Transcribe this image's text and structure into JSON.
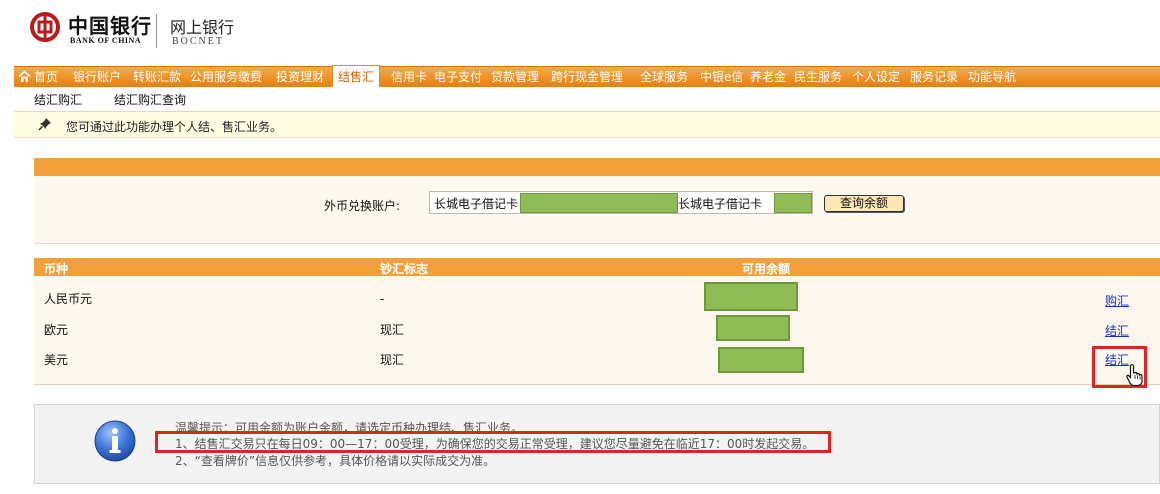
{
  "header": {
    "bank_name_cn": "中国银行",
    "bank_name_en": "BANK OF CHINA",
    "service_cn": "网上银行",
    "service_en": "BOCNET",
    "brand_color": "#b71c1c"
  },
  "nav": {
    "items": [
      "首页",
      "银行账户",
      "转账汇款",
      "公用服务缴费",
      "投资理财",
      "结售汇",
      "信用卡",
      "电子支付",
      "贷款管理",
      "跨行现金管理",
      "全球服务",
      "中银e信",
      "养老金",
      "民生服务",
      "个人设定",
      "服务记录",
      "功能导航"
    ],
    "active": "结售汇",
    "home_icon": "home-icon",
    "color": "#e8860f"
  },
  "subnav": {
    "items": [
      "结汇购汇",
      "结汇购汇查询"
    ]
  },
  "info": {
    "text": "您可通过此功能办理个人结、售汇业务。",
    "icon": "pin-icon"
  },
  "account": {
    "label": "外币兑换账户:",
    "select_prefix": "长城电子借记卡",
    "select_suffix": "长城电子借记卡",
    "query_button": "查询余额"
  },
  "table": {
    "headers": [
      "币种",
      "钞汇标志",
      "可用余额"
    ],
    "rows": [
      {
        "currency": "人民币元",
        "flag": "-",
        "action": "购汇"
      },
      {
        "currency": "欧元",
        "flag": "现汇",
        "action": "结汇"
      },
      {
        "currency": "美元",
        "flag": "现汇",
        "action": "结汇"
      }
    ]
  },
  "tips": {
    "icon": "info-icon",
    "lines": [
      "温馨提示：可用余额为账户余额，请选定币种办理结、售汇业务。",
      "1、结售汇交易只在每日09：00—17：00受理，为确保您的交易正常受理，建议您尽量避免在临近17：00时发起交易。",
      "2、“查看牌价”信息仅供参考，具体价格请以实际成交为准。"
    ]
  },
  "annotations": {
    "highlight_color": "#e02424"
  }
}
